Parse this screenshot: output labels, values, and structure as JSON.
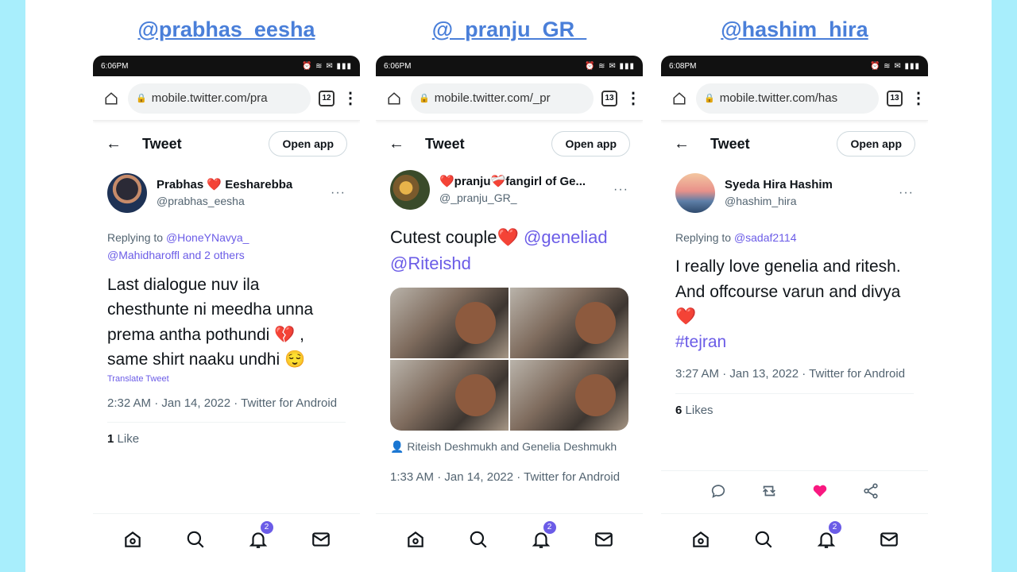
{
  "colors": {
    "accent": "#6b5ce7",
    "title": "#4a7fd9",
    "side": "#a8eefc",
    "like": "#f91880"
  },
  "panels": [
    {
      "handle": "@prabhas_eesha",
      "status_time": "6:06PM",
      "url": "mobile.twitter.com/pra",
      "tabs": "12",
      "header": "Tweet",
      "open_app": "Open app",
      "display_name": "Prabhas ❤️ Eesharebba",
      "username": "@prabhas_eesha",
      "replying_label": "Replying to",
      "replying_to_1": "@HoneYNavya_",
      "replying_to_2": "@Mahidharoffl",
      "replying_others": "and 2 others",
      "text": "Last dialogue nuv ila chesthunte ni meedha unna prema antha pothundi 💔 , same shirt naaku  undhi 😌",
      "translate": "Translate Tweet",
      "time": "2:32 AM · Jan 14, 2022 · Twitter for Android",
      "like_count": "1",
      "like_label": "Like",
      "badge": "2"
    },
    {
      "handle": "@_pranju_GR_",
      "status_time": "6:06PM",
      "url": "mobile.twitter.com/_pr",
      "tabs": "13",
      "header": "Tweet",
      "open_app": "Open app",
      "display_name": "❤️pranju❤️‍🩹fangirl of Ge...",
      "username": "@_pranju_GR_",
      "text_plain": "Cutest couple❤️",
      "mention_1": "@geneliad",
      "mention_2": "@Riteishd",
      "tagged": "Riteish Deshmukh and Genelia Deshmukh",
      "time": "1:33 AM · Jan 14, 2022 · Twitter for Android",
      "badge": "2"
    },
    {
      "handle": "@hashim_hira",
      "status_time": "6:08PM",
      "url": "mobile.twitter.com/has",
      "tabs": "13",
      "header": "Tweet",
      "open_app": "Open app",
      "display_name": "Syeda Hira Hashim",
      "username": "@hashim_hira",
      "replying_label": "Replying to",
      "replying_to_1": "@sadaf2114",
      "text": "I really love genelia and ritesh. And offcourse varun and divya❤️",
      "hashtag": "#tejran",
      "time": "3:27 AM · Jan 13, 2022 · Twitter for Android",
      "like_count": "6",
      "like_label": "Likes",
      "badge": "2"
    }
  ],
  "icons": [
    "home-icon",
    "search-icon",
    "bell-icon",
    "mail-icon",
    "reply-icon",
    "retweet-icon",
    "heart-icon",
    "share-icon",
    "back-arrow-icon",
    "lock-icon",
    "kebab-icon"
  ]
}
